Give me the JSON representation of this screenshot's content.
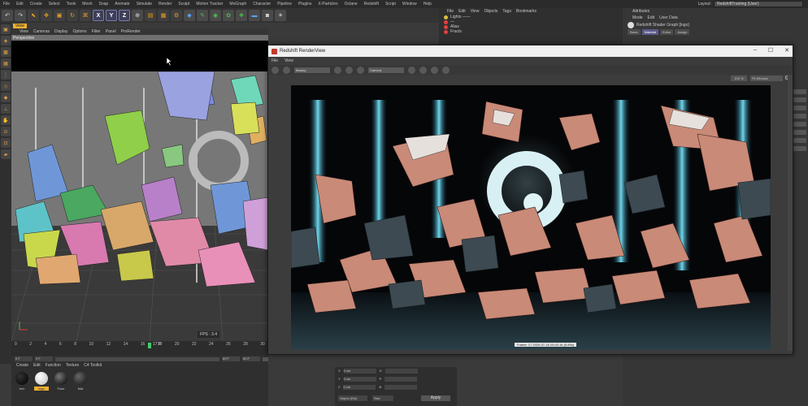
{
  "menubar": {
    "items": [
      "File",
      "Edit",
      "Create",
      "Select",
      "Tools",
      "Mesh",
      "Snap",
      "Animate",
      "Simulate",
      "Render",
      "Sculpt",
      "Motion Tracker",
      "MoGraph",
      "Character",
      "Pipeline",
      "Plugins",
      "X-Particles",
      "Octane",
      "Redshift",
      "Script",
      "Window",
      "Help"
    ],
    "layout_label": "Layout:",
    "layout_value": "RedshiftTraining (User)"
  },
  "toolbar": {
    "axis_x": "X",
    "axis_y": "Y",
    "axis_z": "Z"
  },
  "viewport": {
    "tab": "View",
    "menu": [
      "View",
      "Cameras",
      "Display",
      "Options",
      "Filter",
      "Panel",
      "ProRender"
    ],
    "label": "Perspective",
    "fps": "FPS : 3.4"
  },
  "timeline": {
    "ticks": [
      "0",
      "2",
      "4",
      "6",
      "8",
      "10",
      "12",
      "14",
      "16",
      "18",
      "20",
      "22",
      "24",
      "26",
      "28",
      "30"
    ],
    "current": "17 F",
    "start": "0 F",
    "end": "60 F",
    "range_end": "60 F"
  },
  "material_manager": {
    "menu": [
      "Create",
      "Edit",
      "Function",
      "Texture",
      "C4 Toolkit"
    ],
    "materials": [
      {
        "name": "env",
        "color": "#000000",
        "selected": false
      },
      {
        "name": "logo",
        "color": "#f2f2f2",
        "selected": true
      },
      {
        "name": "Floor",
        "color": "#111111",
        "selected": false
      },
      {
        "name": "Mat",
        "color": "#222222",
        "selected": false
      }
    ]
  },
  "object_manager": {
    "menu": [
      "File",
      "Edit",
      "View",
      "Objects",
      "Tags",
      "Bookmarks"
    ],
    "rows": [
      "Lights ——",
      "—",
      "Alias",
      "Fracts"
    ]
  },
  "attribute_manager": {
    "title": "Attributes",
    "menu": [
      "Mode",
      "Edit",
      "User Data"
    ],
    "object_name": "Redshift Shader Graph [logo]",
    "tabs": [
      "Basic",
      "Material",
      "Editor",
      "Assign"
    ],
    "active_tab": "Material"
  },
  "coordinates": {
    "x_label": "X",
    "y_label": "Y",
    "z_label": "Z",
    "x_val": "0 cm",
    "y_val": "0 cm",
    "z_val": "0 cm",
    "h_label": "H",
    "p_label": "P",
    "b_label": "B",
    "object_mode": "Object (Rel)",
    "size_mode": "Size",
    "apply": "Apply"
  },
  "renderview": {
    "title": "Redshift RenderView",
    "menu": [
      "File",
      "View"
    ],
    "aov": "Beauty",
    "camera_field": "Camera",
    "zoom": "100 %",
    "fit": "Fit Window",
    "status": "Frame: 17  2020-07-16  20:02:16  (5.89s)"
  },
  "colors": {
    "accent": "#f0b030",
    "timeline_marker": "#3fd06a",
    "render_bg": "#050608",
    "light_cyan": "#5fd0e6",
    "copper": "#d9a08a"
  }
}
